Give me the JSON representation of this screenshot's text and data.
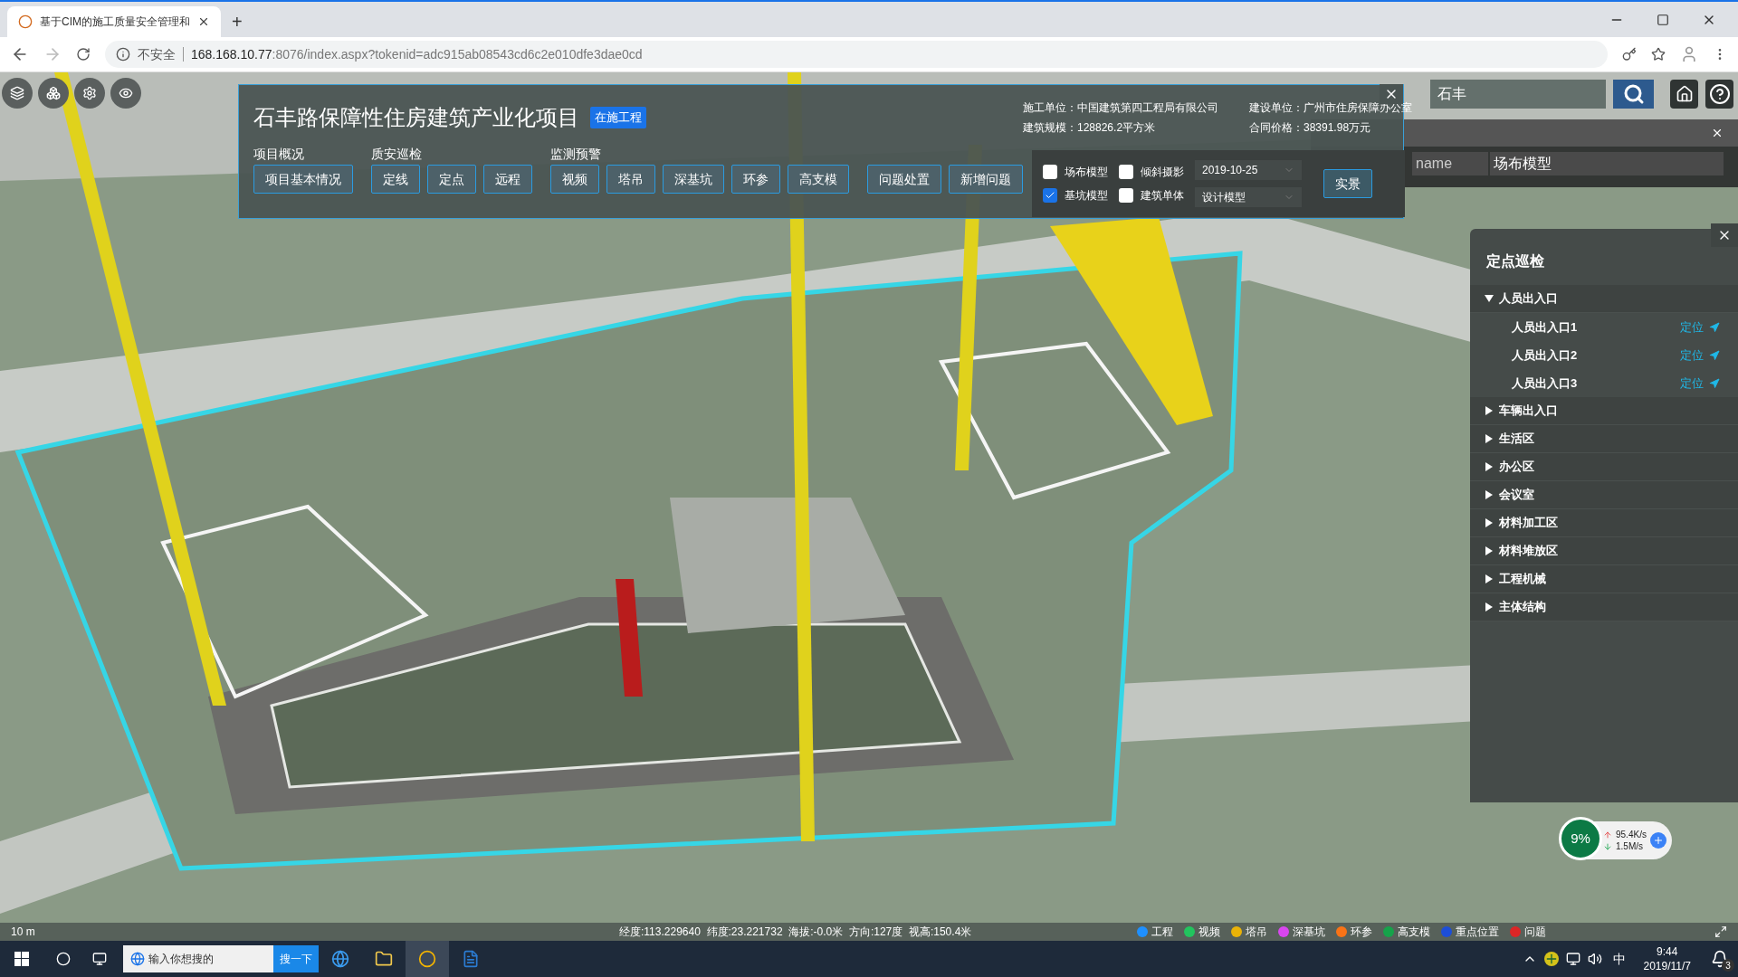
{
  "browser": {
    "tab_title": "基于CIM的施工质量安全管理和",
    "new_tab": "+",
    "security": "不安全",
    "url_host": "168.168.10.77",
    "url_rest": ":8076/index.aspx?tokenid=adc915ab08543cd6c2e010dfe3dae0cd"
  },
  "project": {
    "title": "石丰路保障性住房建筑产业化项目",
    "badge": "在施工程",
    "info": [
      "施工单位：中国建筑第四工程局有限公司",
      "建设单位：广州市住房保障办公室",
      "建筑规模：128826.2平方米",
      "合同价格：38391.98万元"
    ],
    "groups": [
      {
        "label": "项目概况",
        "buttons": [
          "项目基本情况"
        ]
      },
      {
        "label": "质安巡检",
        "buttons": [
          "定线",
          "定点",
          "远程"
        ]
      },
      {
        "label": "监测预警",
        "buttons": [
          "视频",
          "塔吊",
          "深基坑",
          "环参",
          "高支模"
        ]
      },
      {
        "buttons": [
          "问题处置",
          "新增问题"
        ]
      }
    ]
  },
  "layers": {
    "checkboxes": [
      {
        "label": "场布模型",
        "checked": false
      },
      {
        "label": "倾斜摄影",
        "checked": false
      },
      {
        "label": "基坑模型",
        "checked": true
      },
      {
        "label": "建筑单体",
        "checked": false
      }
    ],
    "date": "2019-10-25",
    "model": "设计模型",
    "button": "实景"
  },
  "search": {
    "value": "石丰"
  },
  "layer_table": {
    "column_1": "name",
    "column_2": "场布模型"
  },
  "patrol": {
    "title": "定点巡检",
    "groups": [
      {
        "label": "人员出入口",
        "expanded": true,
        "children": [
          {
            "label": "人员出入口1",
            "action": "定位"
          },
          {
            "label": "人员出入口2",
            "action": "定位"
          },
          {
            "label": "人员出入口3",
            "action": "定位"
          }
        ]
      },
      {
        "label": "车辆出入口",
        "expanded": false
      },
      {
        "label": "生活区",
        "expanded": false
      },
      {
        "label": "办公区",
        "expanded": false
      },
      {
        "label": "会议室",
        "expanded": false
      },
      {
        "label": "材料加工区",
        "expanded": false
      },
      {
        "label": "材料堆放区",
        "expanded": false
      },
      {
        "label": "工程机械",
        "expanded": false
      },
      {
        "label": "主体结构",
        "expanded": false
      }
    ]
  },
  "status": {
    "scale": "10 m",
    "coords": "经度:113.229640  纬度:23.221732  海拔:-0.0米  方向:127度  视高:150.4米",
    "legend": [
      {
        "label": "工程",
        "color": "#1e90ff"
      },
      {
        "label": "视频",
        "color": "#22c55e"
      },
      {
        "label": "塔吊",
        "color": "#eab308"
      },
      {
        "label": "深基坑",
        "color": "#d946ef"
      },
      {
        "label": "环参",
        "color": "#f97316"
      },
      {
        "label": "高支模",
        "color": "#16a34a"
      },
      {
        "label": "重点位置",
        "color": "#1d4ed8"
      },
      {
        "label": "问题",
        "color": "#dc2626"
      }
    ]
  },
  "network": {
    "percent": "9%",
    "up": "95.4K/s",
    "down": "1.5M/s"
  },
  "taskbar": {
    "search_placeholder": "输入你想搜的",
    "search_button": "搜一下",
    "ime": "中",
    "time": "9:44",
    "date": "2019/11/7",
    "notifications": "3"
  }
}
